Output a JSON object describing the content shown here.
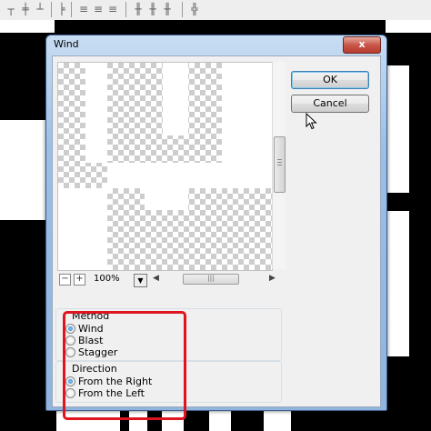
{
  "dialog": {
    "title": "Wind",
    "close_glyph": "x",
    "ok_label": "OK",
    "cancel_label": "Cancel"
  },
  "preview": {
    "zoom_minus": "−",
    "zoom_plus": "+",
    "zoom_value": "100%",
    "zoom_dropdown_icon": "▼",
    "hscroll_left": "◀",
    "hscroll_right": "▶",
    "hscroll_grip": "|||"
  },
  "method": {
    "legend": "Method",
    "options": [
      {
        "label": "Wind",
        "selected": true
      },
      {
        "label": "Blast",
        "selected": false
      },
      {
        "label": "Stagger",
        "selected": false
      }
    ]
  },
  "direction": {
    "legend": "Direction",
    "options": [
      {
        "label": "From the Right",
        "selected": true
      },
      {
        "label": "From the Left",
        "selected": false
      }
    ]
  },
  "icons": [
    "align-left-icon",
    "align-center-icon",
    "align-right-icon",
    "distribute-icon",
    "close-icon",
    "zoom-out-icon",
    "zoom-in-icon",
    "mouse-cursor-icon"
  ],
  "colors": {
    "highlight": "#e0141e",
    "dialog_frame": "#9cbfe6",
    "close_button": "#c8564a"
  }
}
